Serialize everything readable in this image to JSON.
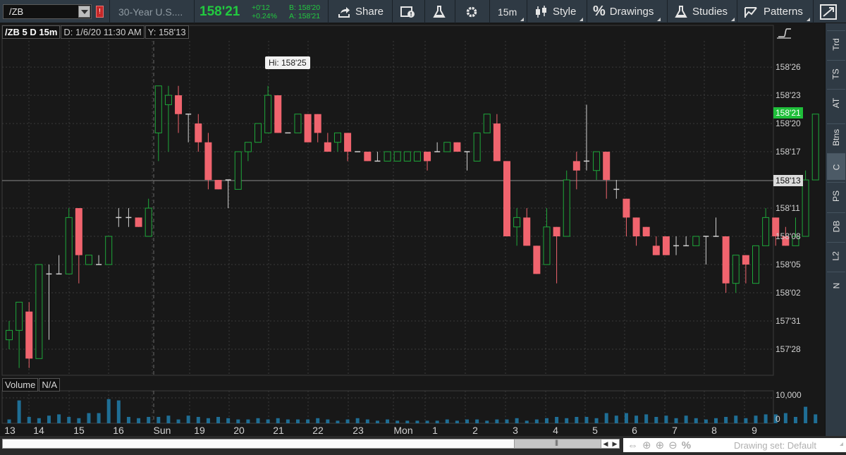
{
  "toolbar": {
    "symbol": "/ZB",
    "flag": "!",
    "description": "30-Year U.S....",
    "last_price": "158'21",
    "net_change": "+0'12",
    "net_change_pct": "+0.24%",
    "bid": "B: 158'20",
    "ask": "A: 158'21",
    "share_label": "Share",
    "timeframe": "15m",
    "style_label": "Style",
    "drawings_label": "Drawings",
    "studies_label": "Studies",
    "patterns_label": "Patterns",
    "colors": {
      "bg": "#2f3a44",
      "up": "#22c93f"
    }
  },
  "chart": {
    "info": {
      "symbol": "/ZB 5 D 15m",
      "date": "D: 1/6/20 11:30 AM",
      "y": "Y: 158'13"
    },
    "hi_label": "Hi: 158'25",
    "volume_label": "Volume",
    "volume_value": "N/A",
    "current_price_tag": "158'21",
    "cursor_price_tag": "158'13",
    "price_axis": [
      "158'26",
      "158'23",
      "158'20",
      "158'17",
      "158'11",
      "158'08",
      "158'05",
      "158'02",
      "157'31",
      "157'28"
    ],
    "volume_axis": [
      "10,000",
      "0"
    ],
    "time_axis": [
      "13",
      "14",
      "15",
      "16",
      "Sun",
      "19",
      "20",
      "21",
      "22",
      "23",
      "Mon",
      "1",
      "2",
      "3",
      "4",
      "5",
      "6",
      "7",
      "8",
      "9"
    ],
    "colors": {
      "up_candle": "#1ea83a",
      "down_candle": "#f0646e",
      "volume": "#1f6e95",
      "grid": "#3a3a3a"
    }
  },
  "chart_data": {
    "type": "candlestick",
    "y_unit": "32nds above 157'00",
    "ylim": [
      54,
      89
    ],
    "candles": [
      {
        "o": 60,
        "h": 62,
        "l": 59,
        "c": 61
      },
      {
        "o": 61,
        "h": 64,
        "l": 57,
        "c": 64
      },
      {
        "o": 63,
        "h": 64,
        "l": 57,
        "c": 58
      },
      {
        "o": 58,
        "h": 68,
        "l": 58,
        "c": 68
      },
      {
        "o": 67,
        "h": 68,
        "l": 60,
        "c": 67
      },
      {
        "o": 67,
        "h": 69,
        "l": 67,
        "c": 67
      },
      {
        "o": 67,
        "h": 74,
        "l": 67,
        "c": 73
      },
      {
        "o": 74,
        "h": 74,
        "l": 66,
        "c": 69
      },
      {
        "o": 68,
        "h": 69,
        "l": 68,
        "c": 69
      },
      {
        "o": 68,
        "h": 69,
        "l": 68,
        "c": 68
      },
      {
        "o": 68,
        "h": 71,
        "l": 68,
        "c": 71
      },
      {
        "o": 73,
        "h": 74,
        "l": 72,
        "c": 73
      },
      {
        "o": 73,
        "h": 74,
        "l": 72,
        "c": 73
      },
      {
        "o": 73,
        "h": 73,
        "l": 72,
        "c": 72
      },
      {
        "o": 71,
        "h": 75,
        "l": 71,
        "c": 74
      },
      {
        "o": 82,
        "h": 86,
        "l": 79,
        "c": 87
      },
      {
        "o": 85,
        "h": 87,
        "l": 80,
        "c": 86
      },
      {
        "o": 86,
        "h": 87,
        "l": 82,
        "c": 84
      },
      {
        "o": 84,
        "h": 84,
        "l": 81,
        "c": 84
      },
      {
        "o": 83,
        "h": 84,
        "l": 80,
        "c": 81
      },
      {
        "o": 81,
        "h": 82,
        "l": 76,
        "c": 77
      },
      {
        "o": 77,
        "h": 77,
        "l": 76,
        "c": 76
      },
      {
        "o": 77,
        "h": 77,
        "l": 74,
        "c": 77
      },
      {
        "o": 76,
        "h": 80,
        "l": 76,
        "c": 80
      },
      {
        "o": 80,
        "h": 80,
        "l": 79,
        "c": 81
      },
      {
        "o": 81,
        "h": 83,
        "l": 81,
        "c": 83
      },
      {
        "o": 82,
        "h": 87,
        "l": 82,
        "c": 86
      },
      {
        "o": 86,
        "h": 86,
        "l": 82,
        "c": 82
      },
      {
        "o": 82,
        "h": 82,
        "l": 82,
        "c": 82
      },
      {
        "o": 82,
        "h": 84,
        "l": 82,
        "c": 84
      },
      {
        "o": 84,
        "h": 84,
        "l": 81,
        "c": 81
      },
      {
        "o": 84,
        "h": 84,
        "l": 81,
        "c": 82
      },
      {
        "o": 81,
        "h": 82,
        "l": 80,
        "c": 80
      },
      {
        "o": 81,
        "h": 82,
        "l": 80,
        "c": 82
      },
      {
        "o": 82,
        "h": 82,
        "l": 79,
        "c": 80
      },
      {
        "o": 80,
        "h": 80,
        "l": 80,
        "c": 80
      },
      {
        "o": 80,
        "h": 80,
        "l": 79,
        "c": 79
      },
      {
        "o": 79,
        "h": 80,
        "l": 79,
        "c": 79
      },
      {
        "o": 79,
        "h": 80,
        "l": 79,
        "c": 80
      },
      {
        "o": 79,
        "h": 80,
        "l": 79,
        "c": 80
      },
      {
        "o": 79,
        "h": 80,
        "l": 79,
        "c": 80
      },
      {
        "o": 79,
        "h": 80,
        "l": 79,
        "c": 80
      },
      {
        "o": 80,
        "h": 80,
        "l": 78,
        "c": 79
      },
      {
        "o": 80,
        "h": 81,
        "l": 80,
        "c": 80
      },
      {
        "o": 80,
        "h": 81,
        "l": 80,
        "c": 81
      },
      {
        "o": 81,
        "h": 81,
        "l": 80,
        "c": 80
      },
      {
        "o": 80,
        "h": 80,
        "l": 78,
        "c": 80
      },
      {
        "o": 79,
        "h": 82,
        "l": 79,
        "c": 82
      },
      {
        "o": 82,
        "h": 84,
        "l": 82,
        "c": 84
      },
      {
        "o": 83,
        "h": 84,
        "l": 79,
        "c": 79
      },
      {
        "o": 79,
        "h": 79,
        "l": 71,
        "c": 71
      },
      {
        "o": 72,
        "h": 74,
        "l": 70,
        "c": 73
      },
      {
        "o": 73,
        "h": 74,
        "l": 70,
        "c": 70
      },
      {
        "o": 70,
        "h": 70,
        "l": 67,
        "c": 67
      },
      {
        "o": 68,
        "h": 74,
        "l": 68,
        "c": 72
      },
      {
        "o": 72,
        "h": 72,
        "l": 66,
        "c": 71
      },
      {
        "o": 71,
        "h": 78,
        "l": 71,
        "c": 77
      },
      {
        "o": 79,
        "h": 80,
        "l": 76,
        "c": 78
      },
      {
        "o": 79,
        "h": 85,
        "l": 78,
        "c": 79
      },
      {
        "o": 78,
        "h": 80,
        "l": 77,
        "c": 80
      },
      {
        "o": 80,
        "h": 80,
        "l": 75,
        "c": 77
      },
      {
        "o": 76,
        "h": 77,
        "l": 75,
        "c": 76
      },
      {
        "o": 75,
        "h": 75,
        "l": 71,
        "c": 73
      },
      {
        "o": 73,
        "h": 73,
        "l": 70,
        "c": 71
      },
      {
        "o": 72,
        "h": 72,
        "l": 71,
        "c": 71
      },
      {
        "o": 70,
        "h": 71,
        "l": 69,
        "c": 69
      },
      {
        "o": 71,
        "h": 71,
        "l": 69,
        "c": 69
      },
      {
        "o": 70,
        "h": 71,
        "l": 69,
        "c": 70
      },
      {
        "o": 70,
        "h": 71,
        "l": 70,
        "c": 70
      },
      {
        "o": 70,
        "h": 71,
        "l": 70,
        "c": 71
      },
      {
        "o": 71,
        "h": 71,
        "l": 68,
        "c": 71
      },
      {
        "o": 71,
        "h": 73,
        "l": 71,
        "c": 71
      },
      {
        "o": 71,
        "h": 71,
        "l": 65,
        "c": 66
      },
      {
        "o": 66,
        "h": 69,
        "l": 65,
        "c": 69
      },
      {
        "o": 69,
        "h": 69,
        "l": 66,
        "c": 68
      },
      {
        "o": 66,
        "h": 70,
        "l": 66,
        "c": 70
      },
      {
        "o": 70,
        "h": 74,
        "l": 70,
        "c": 73
      },
      {
        "o": 73,
        "h": 73,
        "l": 70,
        "c": 71
      },
      {
        "o": 71,
        "h": 72,
        "l": 70,
        "c": 70
      },
      {
        "o": 70,
        "h": 73,
        "l": 70,
        "c": 71
      },
      {
        "o": 71,
        "h": 78,
        "l": 71,
        "c": 77
      },
      {
        "o": 77,
        "h": 84,
        "l": 77,
        "c": 84
      }
    ],
    "volume": [
      0.15,
      0.9,
      0.25,
      0.2,
      0.3,
      0.35,
      0.25,
      0.2,
      0.4,
      0.4,
      0.95,
      0.9,
      0.25,
      0.2,
      0.25,
      0.25,
      0.3,
      0.15,
      0.3,
      0.25,
      0.2,
      0.25,
      0.2,
      0.15,
      0.15,
      0.2,
      0.15,
      0.2,
      0.15,
      0.15,
      0.15,
      0.2,
      0.15,
      0.1,
      0.15,
      0.2,
      0.15,
      0.1,
      0.15,
      0.1,
      0.1,
      0.1,
      0.1,
      0.1,
      0.15,
      0.1,
      0.15,
      0.15,
      0.1,
      0.15,
      0.15,
      0.2,
      0.1,
      0.15,
      0.2,
      0.25,
      0.2,
      0.25,
      0.25,
      0.2,
      0.4,
      0.3,
      0.4,
      0.3,
      0.35,
      0.25,
      0.3,
      0.2,
      0.3,
      0.2,
      0.15,
      0.2,
      0.25,
      0.3,
      0.2,
      0.3,
      0.35,
      0.35,
      0.4,
      0.25,
      0.65,
      0.35
    ]
  },
  "side_tabs": [
    "Trd",
    "TS",
    "AT",
    "Btns",
    "C",
    "PS",
    "DB",
    "L2",
    "N"
  ],
  "bottom": {
    "drawing_set": "Drawing set: Default"
  }
}
